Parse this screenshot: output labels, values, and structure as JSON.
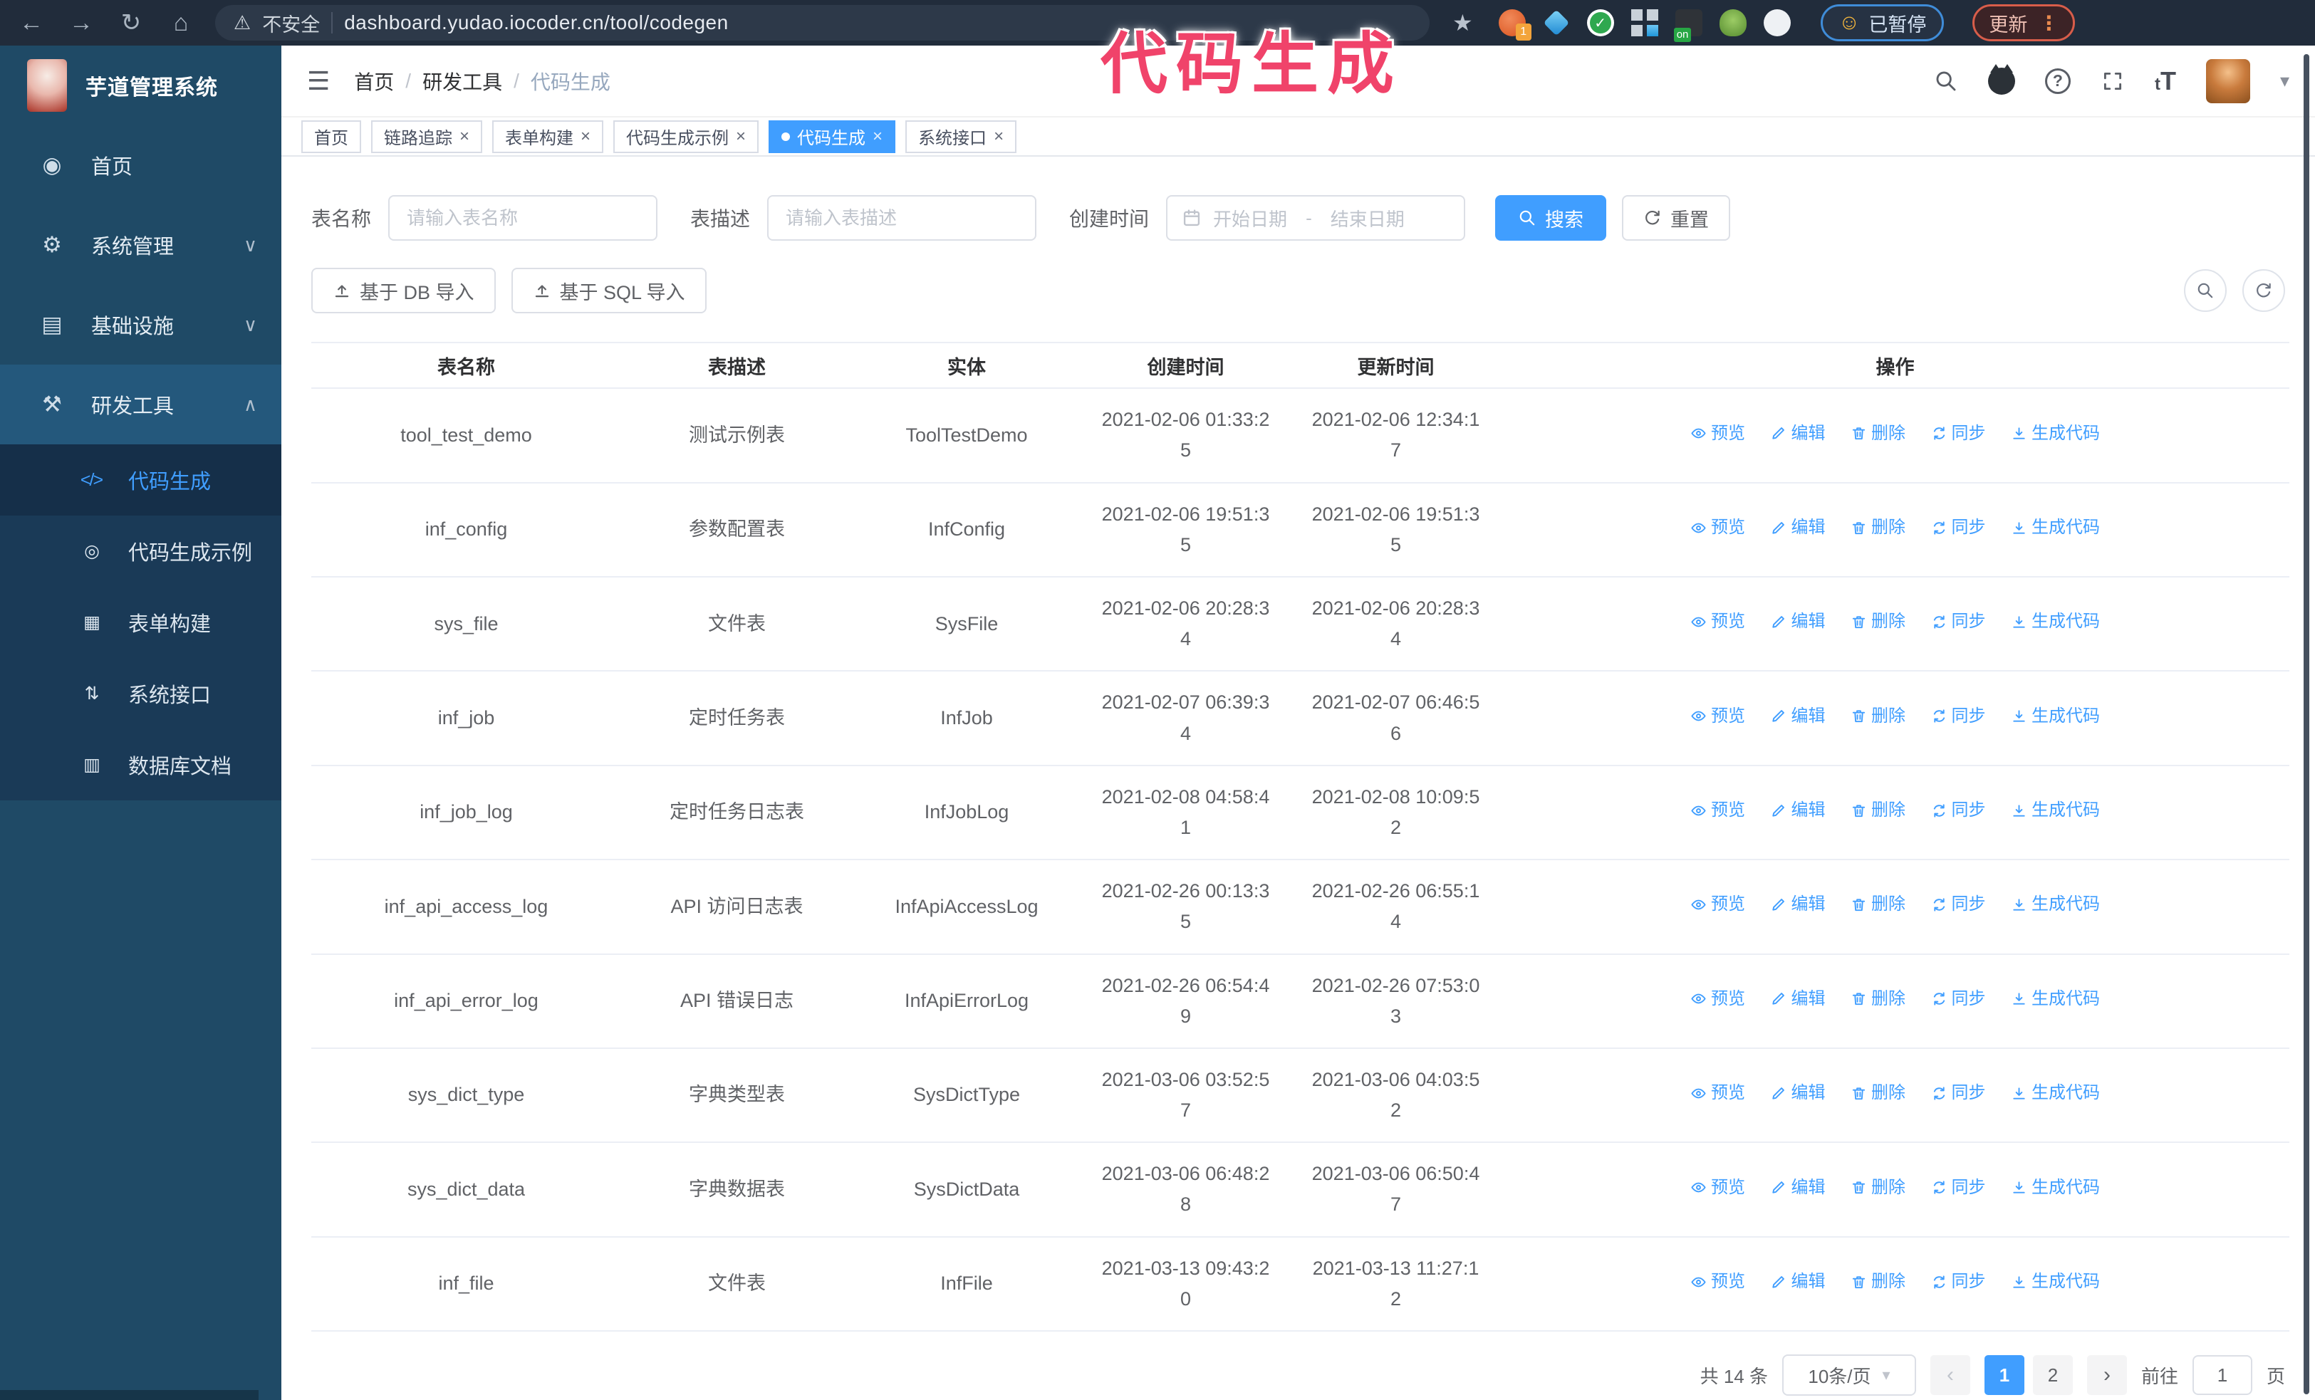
{
  "browser": {
    "security_label": "不安全",
    "url": "dashboard.yudao.iocoder.cn/tool/codegen",
    "paused_label": "已暂停",
    "update_label": "更新"
  },
  "icons": {
    "back": "←",
    "forward": "→",
    "reload": "↻",
    "home": "⌂",
    "warning": "⚠",
    "star": "★",
    "face": "☺",
    "menu_dots": "⋮",
    "hamburger": "☰",
    "question": "?",
    "font_size": "tT",
    "caret_down": "▾",
    "close": "×",
    "prev": "‹",
    "next": "›",
    "check": "✓",
    "on_badge": "on",
    "badge_one": "1"
  },
  "annotation": {
    "text": "代码生成"
  },
  "sidebar": {
    "title": "芋道管理系统",
    "items": [
      {
        "label": "首页",
        "icon": "◉"
      },
      {
        "label": "系统管理",
        "icon": "⚙",
        "arrow": "∨"
      },
      {
        "label": "基础设施",
        "icon": "▤",
        "arrow": "∨"
      },
      {
        "label": "研发工具",
        "icon": "⚒",
        "arrow": "∧",
        "expanded": true
      }
    ],
    "submenu": [
      {
        "label": "代码生成",
        "icon": "</>",
        "active": true
      },
      {
        "label": "代码生成示例",
        "icon": "◎"
      },
      {
        "label": "表单构建",
        "icon": "▦"
      },
      {
        "label": "系统接口",
        "icon": "⇅"
      },
      {
        "label": "数据库文档",
        "icon": "▥"
      }
    ]
  },
  "header": {
    "breadcrumb": [
      "首页",
      "研发工具",
      "代码生成"
    ]
  },
  "tabs": [
    {
      "label": "首页",
      "closable": false,
      "active": false
    },
    {
      "label": "链路追踪",
      "closable": true,
      "active": false
    },
    {
      "label": "表单构建",
      "closable": true,
      "active": false
    },
    {
      "label": "代码生成示例",
      "closable": true,
      "active": false
    },
    {
      "label": "代码生成",
      "closable": true,
      "active": true
    },
    {
      "label": "系统接口",
      "closable": true,
      "active": false
    }
  ],
  "filters": {
    "table_name_label": "表名称",
    "table_name_placeholder": "请输入表名称",
    "table_desc_label": "表描述",
    "table_desc_placeholder": "请输入表描述",
    "create_time_label": "创建时间",
    "start_date_placeholder": "开始日期",
    "range_separator": "-",
    "end_date_placeholder": "结束日期",
    "search_button": "搜索",
    "reset_button": "重置"
  },
  "toolbar": {
    "import_db_button": "基于 DB 导入",
    "import_sql_button": "基于 SQL 导入"
  },
  "table": {
    "columns": [
      "表名称",
      "表描述",
      "实体",
      "创建时间",
      "更新时间",
      "操作"
    ],
    "actions": [
      "预览",
      "编辑",
      "删除",
      "同步",
      "生成代码"
    ],
    "rows": [
      {
        "name": "tool_test_demo",
        "desc": "测试示例表",
        "entity": "ToolTestDemo",
        "created": "2021-02-06 01:33:25",
        "updated": "2021-02-06 12:34:17"
      },
      {
        "name": "inf_config",
        "desc": "参数配置表",
        "entity": "InfConfig",
        "created": "2021-02-06 19:51:35",
        "updated": "2021-02-06 19:51:35"
      },
      {
        "name": "sys_file",
        "desc": "文件表",
        "entity": "SysFile",
        "created": "2021-02-06 20:28:34",
        "updated": "2021-02-06 20:28:34"
      },
      {
        "name": "inf_job",
        "desc": "定时任务表",
        "entity": "InfJob",
        "created": "2021-02-07 06:39:34",
        "updated": "2021-02-07 06:46:56"
      },
      {
        "name": "inf_job_log",
        "desc": "定时任务日志表",
        "entity": "InfJobLog",
        "created": "2021-02-08 04:58:41",
        "updated": "2021-02-08 10:09:52"
      },
      {
        "name": "inf_api_access_log",
        "desc": "API 访问日志表",
        "entity": "InfApiAccessLog",
        "created": "2021-02-26 00:13:35",
        "updated": "2021-02-26 06:55:14"
      },
      {
        "name": "inf_api_error_log",
        "desc": "API 错误日志",
        "entity": "InfApiErrorLog",
        "created": "2021-02-26 06:54:49",
        "updated": "2021-02-26 07:53:03"
      },
      {
        "name": "sys_dict_type",
        "desc": "字典类型表",
        "entity": "SysDictType",
        "created": "2021-03-06 03:52:57",
        "updated": "2021-03-06 04:03:52"
      },
      {
        "name": "sys_dict_data",
        "desc": "字典数据表",
        "entity": "SysDictData",
        "created": "2021-03-06 06:48:28",
        "updated": "2021-03-06 06:50:47"
      },
      {
        "name": "inf_file",
        "desc": "文件表",
        "entity": "InfFile",
        "created": "2021-03-13 09:43:20",
        "updated": "2021-03-13 11:27:12"
      }
    ]
  },
  "pagination": {
    "total": "共 14 条",
    "page_size": "10条/页",
    "pages": [
      {
        "label": "1",
        "active": true
      },
      {
        "label": "2",
        "active": false
      }
    ],
    "goto_label": "前往",
    "goto_value": "1",
    "page_suffix": "页"
  }
}
